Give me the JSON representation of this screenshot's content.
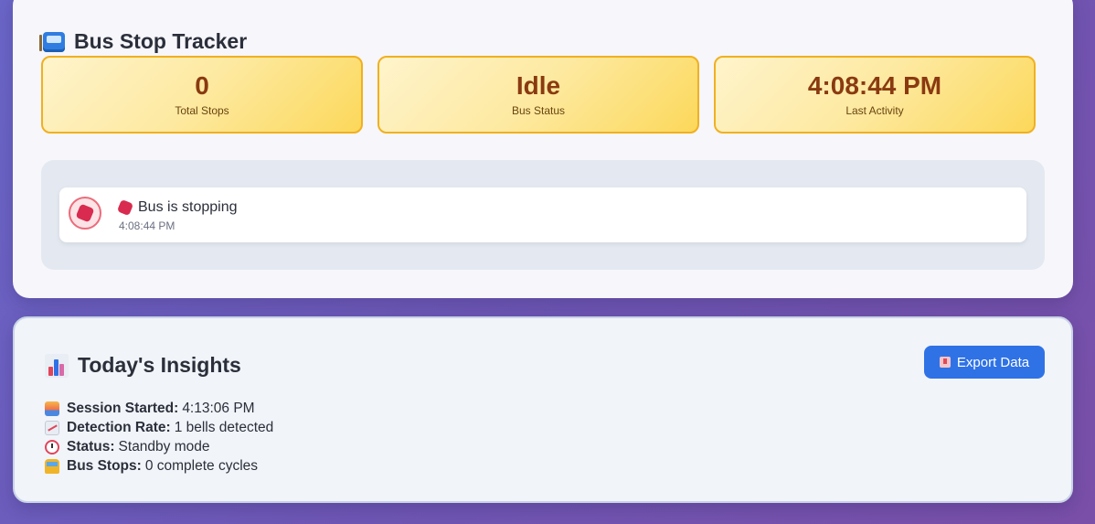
{
  "tracker": {
    "title": "Bus Stop Tracker",
    "title_icon": "bus-stop-icon",
    "stats": [
      {
        "value": "0",
        "label": "Total Stops"
      },
      {
        "value": "Idle",
        "label": "Bus Status"
      },
      {
        "value": "4:08:44 PM",
        "label": "Last Activity"
      }
    ],
    "log": [
      {
        "icon": "stop-sign-icon",
        "title": "Bus is stopping",
        "time": "4:08:44 PM"
      }
    ]
  },
  "insights": {
    "title": "Today's Insights",
    "title_icon": "bar-chart-icon",
    "export_label": "Export Data",
    "rows": [
      {
        "icon": "sunrise-icon",
        "label": "Session Started:",
        "value": "4:13:06 PM"
      },
      {
        "icon": "trend-chart-icon",
        "label": "Detection Rate:",
        "value": "1 bells detected"
      },
      {
        "icon": "alarm-clock-icon",
        "label": "Status:",
        "value": "Standby mode"
      },
      {
        "icon": "bus-icon",
        "label": "Bus Stops:",
        "value": "0 complete cycles"
      }
    ]
  },
  "colors": {
    "accent": "#2f72e6",
    "stat_border": "#f0b020",
    "stat_text": "#8a3a10",
    "stop_red": "#d92b4f"
  }
}
